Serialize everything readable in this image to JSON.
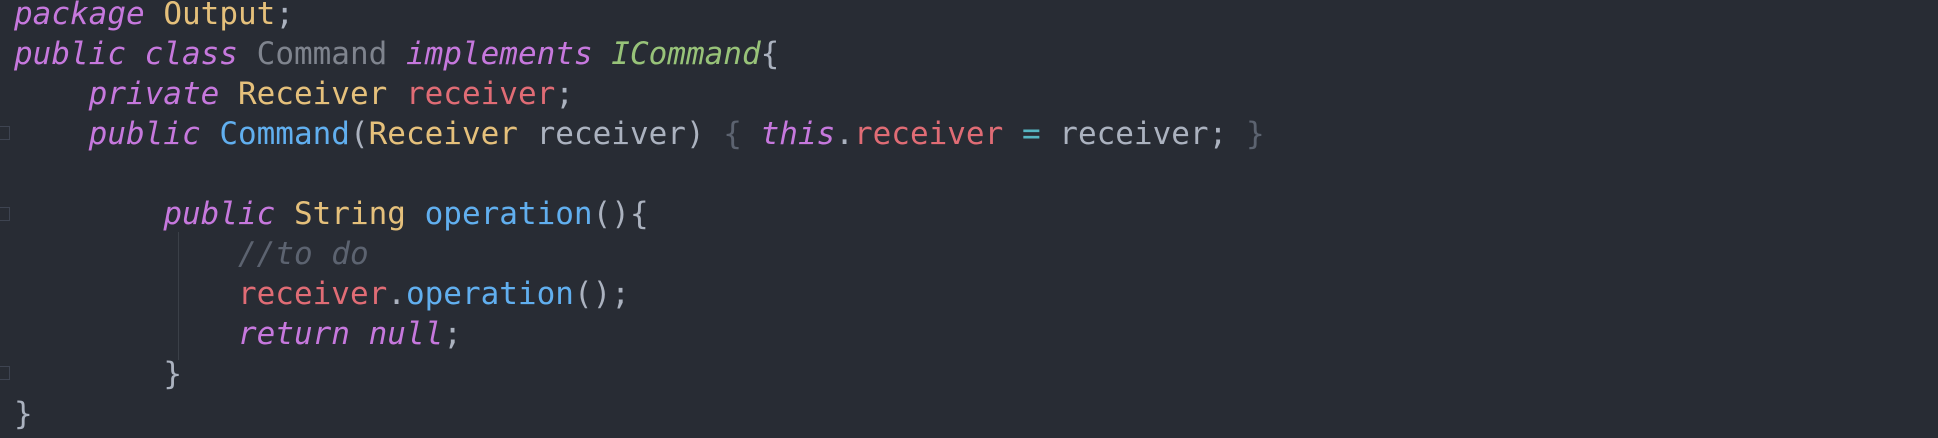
{
  "code": {
    "line1": {
      "keyword": "package",
      "name": "Output",
      "semicolon": ";"
    },
    "line2": {
      "kw_public": "public",
      "kw_class": "class",
      "class_name": "Command",
      "kw_implements": "implements",
      "interface_name": "ICommand",
      "brace": "{"
    },
    "line3": {
      "kw_private": "private",
      "type": "Receiver",
      "field": "receiver",
      "semicolon": ";"
    },
    "line4": {
      "kw_public": "public",
      "ctor_name": "Command",
      "lparen": "(",
      "param_type": "Receiver",
      "param_name": "receiver",
      "rparen": ")",
      "open_brace": "{",
      "kw_this": "this",
      "dot": ".",
      "field": "receiver",
      "assign": "=",
      "value": "receiver",
      "semicolon": ";",
      "close_brace": "}"
    },
    "line6": {
      "kw_public": "public",
      "type": "String",
      "method": "operation",
      "parens": "()",
      "brace": "{"
    },
    "line7": {
      "comment": "//to do"
    },
    "line8": {
      "object": "receiver",
      "dot": ".",
      "method": "operation",
      "call": "();"
    },
    "line9": {
      "kw_return": "return",
      "kw_null": "null",
      "semicolon": ";"
    },
    "line10": {
      "brace": "}"
    },
    "line11": {
      "brace": "}"
    }
  },
  "colors": {
    "background": "#282c34",
    "keyword": "#c678dd",
    "type": "#e5c07b",
    "field": "#e06c75",
    "function": "#61afef",
    "interface": "#98c379",
    "operator": "#56b6c2",
    "text": "#abb2bf",
    "comment": "#5c6370"
  }
}
